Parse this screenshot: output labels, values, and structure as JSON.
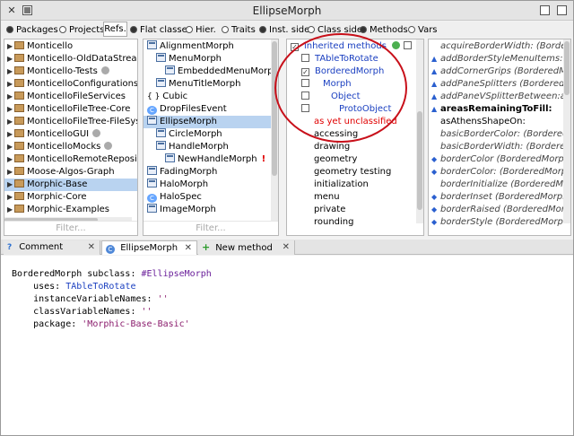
{
  "window": {
    "title": "EllipseMorph"
  },
  "options": {
    "packages": "Packages",
    "projects": "Projects",
    "refs": "Refs.",
    "flat_classes": "Flat classes",
    "hier": "Hier.",
    "traits": "Traits",
    "inst_side": "Inst. side",
    "class_side": "Class side",
    "methods": "Methods",
    "vars": "Vars"
  },
  "packages": {
    "items": [
      {
        "label": "Monticello",
        "dot": false
      },
      {
        "label": "Monticello-OldDataStreamCo",
        "dot": false
      },
      {
        "label": "Monticello-Tests",
        "dot": true
      },
      {
        "label": "MonticelloConfigurations",
        "dot": false
      },
      {
        "label": "MonticelloFileServices",
        "dot": false
      },
      {
        "label": "MonticelloFileTree-Core",
        "dot": false
      },
      {
        "label": "MonticelloFileTree-FileSysten",
        "dot": false
      },
      {
        "label": "MonticelloGUI",
        "dot": true
      },
      {
        "label": "MonticelloMocks",
        "dot": true
      },
      {
        "label": "MonticelloRemoteRepositorie",
        "dot": false
      },
      {
        "label": "Moose-Algos-Graph",
        "dot": false
      },
      {
        "label": "Morphic-Base",
        "dot": false,
        "selected": true
      },
      {
        "label": "Morphic-Core",
        "dot": false
      },
      {
        "label": "Morphic-Examples",
        "dot": false
      }
    ],
    "filter_placeholder": "Filter..."
  },
  "classes": {
    "items": [
      {
        "label": "AlignmentMorph",
        "indent": 0,
        "icon": "class"
      },
      {
        "label": "MenuMorph",
        "indent": 1,
        "icon": "class"
      },
      {
        "label": "EmbeddedMenuMorph",
        "indent": 2,
        "icon": "class"
      },
      {
        "label": "MenuTitleMorph",
        "indent": 1,
        "icon": "class"
      },
      {
        "label": "Cubic",
        "indent": 0,
        "icon": "brace"
      },
      {
        "label": "DropFilesEvent",
        "indent": 0,
        "icon": "trait"
      },
      {
        "label": "EllipseMorph",
        "indent": 0,
        "icon": "class",
        "selected": true
      },
      {
        "label": "CircleMorph",
        "indent": 1,
        "icon": "class"
      },
      {
        "label": "HandleMorph",
        "indent": 1,
        "icon": "class"
      },
      {
        "label": "NewHandleMorph",
        "indent": 2,
        "icon": "class",
        "warn": "!"
      },
      {
        "label": "FadingMorph",
        "indent": 0,
        "icon": "class"
      },
      {
        "label": "HaloMorph",
        "indent": 0,
        "icon": "class"
      },
      {
        "label": "HaloSpec",
        "indent": 0,
        "icon": "trait"
      },
      {
        "label": "ImageMorph",
        "indent": 0,
        "icon": "class"
      }
    ],
    "filter_placeholder": "Filter..."
  },
  "protocols": {
    "inherited_label": "inherited methods",
    "hierarchy": [
      {
        "label": "TAbleToRotate",
        "indent": 0,
        "checked": false
      },
      {
        "label": "BorderedMorph",
        "indent": 0,
        "checked": true
      },
      {
        "label": "Morph",
        "indent": 1,
        "checked": false
      },
      {
        "label": "Object",
        "indent": 2,
        "checked": false
      },
      {
        "label": "ProtoObject",
        "indent": 3,
        "checked": false
      }
    ],
    "unclassified": "as yet unclassified",
    "items": [
      "accessing",
      "drawing",
      "geometry",
      "geometry testing",
      "initialization",
      "menu",
      "private",
      "rounding"
    ]
  },
  "methods": {
    "items": [
      {
        "label": "acquireBorderWidth: (BorderedM",
        "style": "italic",
        "icon": "none"
      },
      {
        "label": "addBorderStyleMenuItems:hand",
        "style": "italic",
        "icon": "up"
      },
      {
        "label": "addCornerGrips (BorderedMorph)",
        "style": "italic",
        "icon": "up"
      },
      {
        "label": "addPaneSplitters (BorderedMorph",
        "style": "italic",
        "icon": "up"
      },
      {
        "label": "addPaneVSplitterBetween:and: (",
        "style": "italic",
        "icon": "up"
      },
      {
        "label": "areasRemainingToFill:",
        "style": "bold",
        "icon": "up"
      },
      {
        "label": "asAthensShapeOn:",
        "style": "plain",
        "icon": "none"
      },
      {
        "label": "basicBorderColor: (BorderedM",
        "style": "italic",
        "icon": "none"
      },
      {
        "label": "basicBorderWidth: (BorderedMo",
        "style": "italic",
        "icon": "none"
      },
      {
        "label": "borderColor (BorderedMorph)",
        "style": "italic",
        "icon": "updown"
      },
      {
        "label": "borderColor: (BorderedMorph)",
        "style": "italic",
        "icon": "updown"
      },
      {
        "label": "borderInitialize (BorderedMorp",
        "style": "italic",
        "icon": "none"
      },
      {
        "label": "borderInset (BorderedMorph)",
        "style": "italic",
        "icon": "updown"
      },
      {
        "label": "borderRaised (BorderedMorph)",
        "style": "italic",
        "icon": "updown"
      },
      {
        "label": "borderStyle (BorderedMorph)",
        "style": "italic",
        "icon": "updown"
      }
    ]
  },
  "tabs": [
    {
      "label": "Comment",
      "icon": "?"
    },
    {
      "label": "EllipseMorph",
      "icon": "C"
    },
    {
      "label": "New method",
      "icon": "+"
    }
  ],
  "code": {
    "lines": [
      {
        "parts": [
          {
            "t": "BorderedMorph subclass: ",
            "c": ""
          },
          {
            "t": "#EllipseMorph",
            "c": "sym"
          }
        ]
      },
      {
        "parts": [
          {
            "t": "    uses: ",
            "c": ""
          },
          {
            "t": "TAbleToRotate",
            "c": "cn"
          }
        ]
      },
      {
        "parts": [
          {
            "t": "    instanceVariableNames: ",
            "c": ""
          },
          {
            "t": "''",
            "c": "str"
          }
        ]
      },
      {
        "parts": [
          {
            "t": "    classVariableNames: ",
            "c": ""
          },
          {
            "t": "''",
            "c": "str"
          }
        ]
      },
      {
        "parts": [
          {
            "t": "    package: ",
            "c": ""
          },
          {
            "t": "'Morphic-Base-Basic'",
            "c": "str"
          }
        ]
      }
    ]
  }
}
